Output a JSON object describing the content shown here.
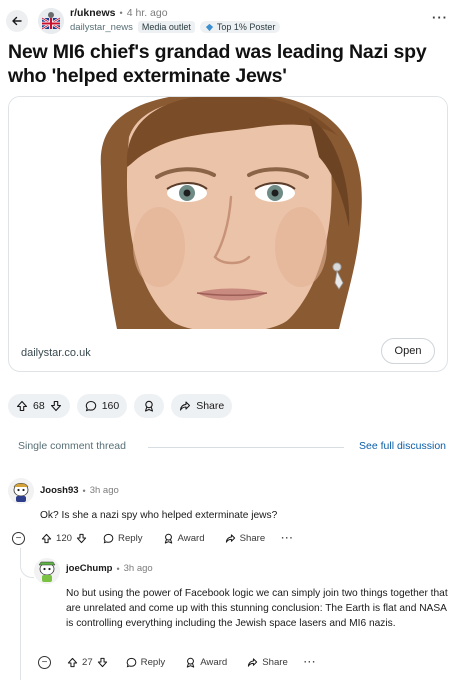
{
  "post": {
    "subreddit": "r/uknews",
    "time": "4 hr. ago",
    "author": "dailystar_news",
    "author_flair": "Media outlet",
    "badge": "Top 1% Poster",
    "title": "New MI6 chief's grandad was leading Nazi spy who 'helped exterminate Jews'",
    "link_domain": "dailystar.co.uk",
    "open_label": "Open",
    "votes": "68",
    "comments": "160",
    "share_label": "Share"
  },
  "thread": {
    "single_label": "Single comment thread",
    "see_full_label": "See full discussion"
  },
  "comments": [
    {
      "author": "Joosh93",
      "time": "3h ago",
      "text": "Ok? Is she a nazi spy who helped exterminate jews?",
      "votes": "120",
      "reply_label": "Reply",
      "award_label": "Award",
      "share_label": "Share"
    },
    {
      "author": "joeChump",
      "time": "3h ago",
      "text": "No but using the power of Facebook logic we can simply join two things together that are unrelated and come up with this stunning conclusion: The Earth is flat and NASA is controlling everything including the Jewish space lasers and MI6 nazis.",
      "votes": "27",
      "reply_label": "Reply",
      "award_label": "Award",
      "share_label": "Share"
    }
  ],
  "colors": {
    "accent_link": "#0a5ea8",
    "pill_bg": "#eef1f3",
    "muted_text": "#576f76"
  },
  "icons": [
    "back-arrow-icon",
    "more-icon",
    "upvote-icon",
    "downvote-icon",
    "comment-icon",
    "award-icon",
    "share-icon",
    "collapse-icon"
  ]
}
